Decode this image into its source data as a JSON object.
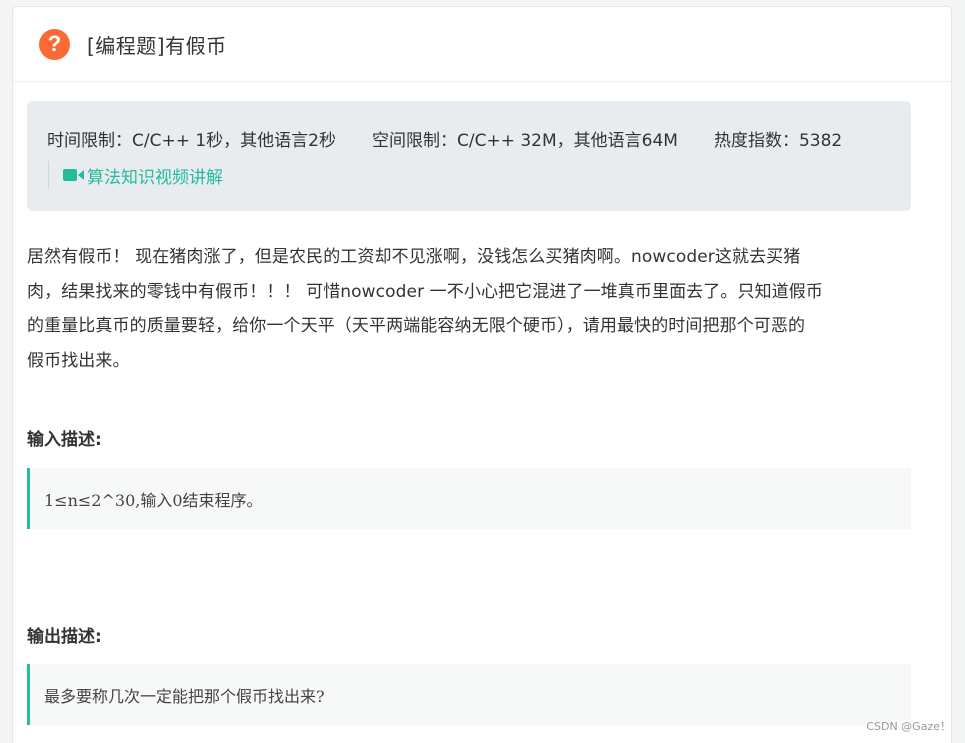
{
  "header": {
    "icon": "question-icon",
    "icon_glyph": "?",
    "title": "[编程题]有假币"
  },
  "meta": {
    "time_limit": "时间限制：C/C++ 1秒，其他语言2秒",
    "space_limit": "空间限制：C/C++ 32M，其他语言64M",
    "heat": "热度指数：5382",
    "video_link": "算法知识视频讲解"
  },
  "description": {
    "lines": [
      "居然有假币！ 现在猪肉涨了，但是农民的工资却不见涨啊，没钱怎么买猪肉啊。nowcoder这就去买猪",
      "肉，结果找来的零钱中有假币！！！ 可惜nowcoder 一不小心把它混进了一堆真币里面去了。只知道假币",
      "的重量比真币的质量要轻，给你一个天平（天平两端能容纳无限个硬币），请用最快的时间把那个可恶的",
      "假币找出来。"
    ]
  },
  "input": {
    "title": "输入描述:",
    "text": "1≤n≤2^30,输入0结束程序。"
  },
  "output": {
    "title": "输出描述:",
    "text": "最多要称几次一定能把那个假币找出来?"
  },
  "watermark": "CSDN @Gaze！",
  "colors": {
    "accent": "#25bb9b",
    "question_icon": "#fa6a35",
    "meta_bg": "#e8ecef"
  }
}
